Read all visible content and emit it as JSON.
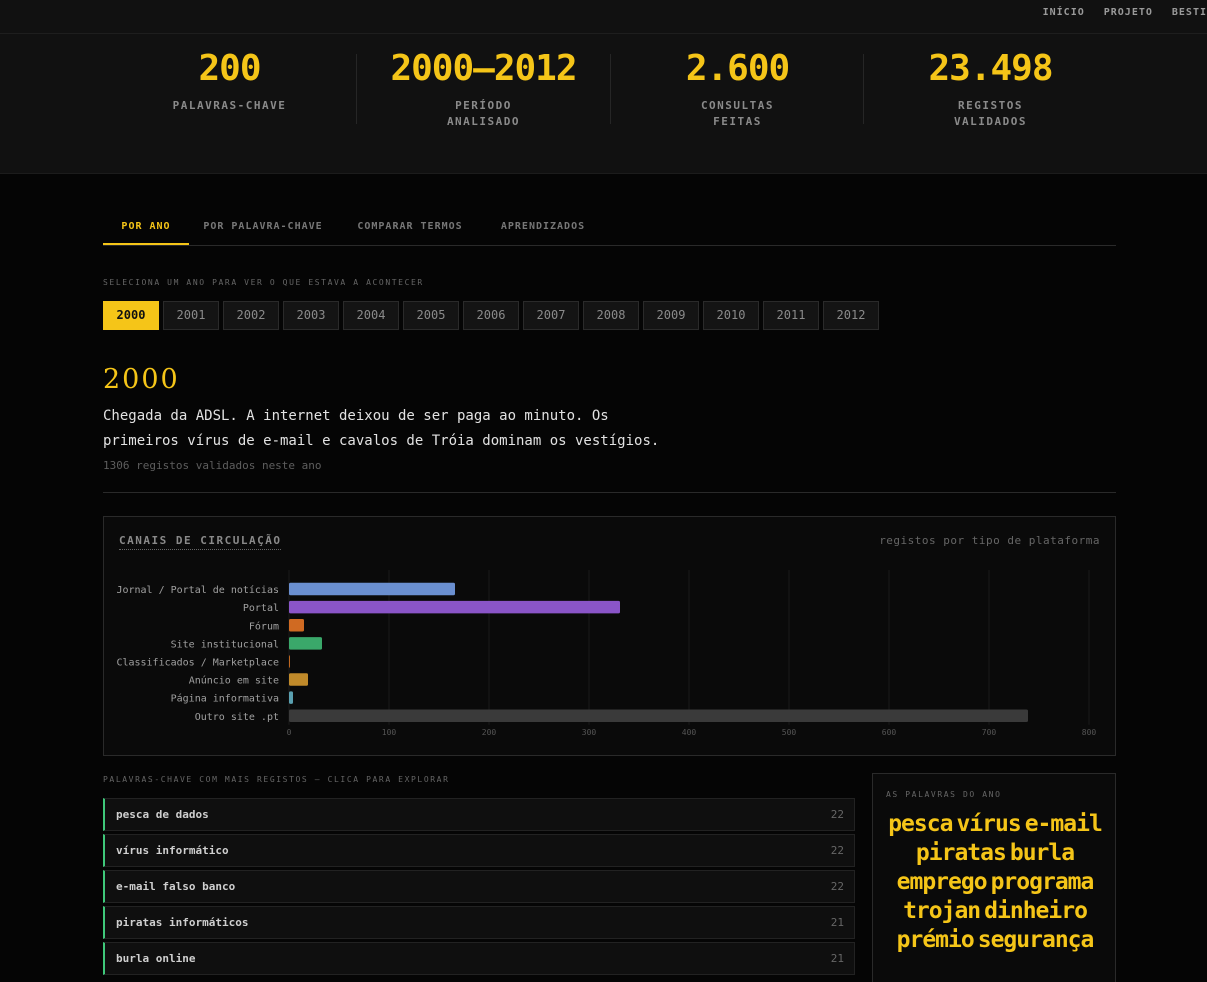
{
  "nav": {
    "links": [
      "INÍCIO",
      "PROJETO",
      "BESTI"
    ]
  },
  "stats": [
    {
      "value": "200",
      "label": "PALAVRAS-CHAVE"
    },
    {
      "value": "2000–2012",
      "label": "PERÍODO\nANALISADO"
    },
    {
      "value": "2.600",
      "label": "CONSULTAS\nFEITAS"
    },
    {
      "value": "23.498",
      "label": "REGISTOS\nVALIDADOS"
    }
  ],
  "tabs": [
    {
      "label": "POR ANO",
      "active": true
    },
    {
      "label": "POR PALAVRA-CHAVE",
      "active": false
    },
    {
      "label": "COMPARAR TERMOS",
      "active": false
    },
    {
      "label": "APRENDIZADOS",
      "active": false
    }
  ],
  "year_hint": "SELECIONA UM ANO PARA VER O QUE ESTAVA A ACONTECER",
  "years": [
    "2000",
    "2001",
    "2002",
    "2003",
    "2004",
    "2005",
    "2006",
    "2007",
    "2008",
    "2009",
    "2010",
    "2011",
    "2012"
  ],
  "selected_year": "2000",
  "year_panel": {
    "title": "2000",
    "description": "Chegada da ADSL. A internet deixou de ser paga ao minuto. Os primeiros vírus de e-mail e cavalos de Tróia dominam os vestígios.",
    "count_text": "1306 registos validados neste ano"
  },
  "chart_title": "CANAIS DE CIRCULAÇÃO",
  "chart_subtitle": "registos por tipo de plataforma",
  "chart_data": {
    "type": "bar",
    "orientation": "horizontal",
    "categories": [
      "Jornal / Portal de notícias",
      "Portal",
      "Fórum",
      "Site institucional",
      "Classificados / Marketplace",
      "Anúncio em site",
      "Página informativa",
      "Outro site .pt"
    ],
    "values": [
      166,
      331,
      15,
      33,
      1,
      19,
      4,
      739
    ],
    "colors": [
      "#6a8fd0",
      "#8a55c8",
      "#d06a22",
      "#3aa86a",
      "#c06820",
      "#c08a2a",
      "#5aa0b0",
      "#3a3a3a"
    ],
    "xlim": [
      0,
      800
    ],
    "xticks": [
      0,
      100,
      200,
      300,
      400,
      500,
      600,
      700,
      800
    ],
    "grid": true
  },
  "keywords_hint": "PALAVRAS-CHAVE COM MAIS REGISTOS — CLICA PARA EXPLORAR",
  "keywords": [
    {
      "name": "pesca de dados",
      "count": "22"
    },
    {
      "name": "vírus informático",
      "count": "22"
    },
    {
      "name": "e-mail falso banco",
      "count": "22"
    },
    {
      "name": "piratas informáticos",
      "count": "21"
    },
    {
      "name": "burla online",
      "count": "21"
    }
  ],
  "words_box": {
    "title": "AS PALAVRAS DO ANO",
    "words": [
      "pesca",
      "vírus",
      "e-mail",
      "piratas",
      "burla",
      "emprego",
      "programa",
      "trojan",
      "dinheiro",
      "prémio",
      "segurança"
    ]
  }
}
